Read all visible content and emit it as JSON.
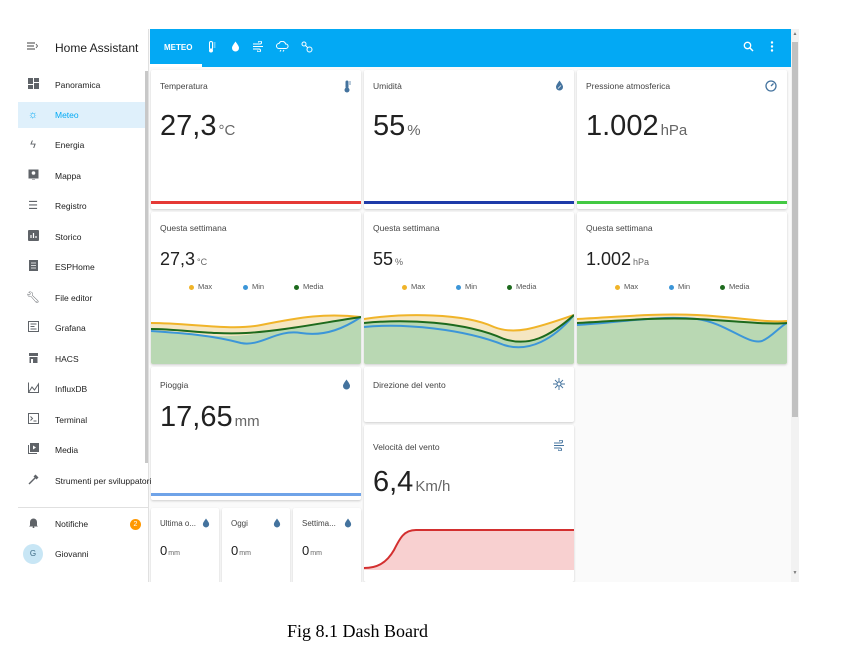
{
  "app_title": "Home Assistant",
  "sidebar": {
    "items": [
      {
        "label": "Panoramica",
        "icon": "dashboard-icon"
      },
      {
        "label": "Meteo",
        "icon": "weather-icon",
        "active": true
      },
      {
        "label": "Energia",
        "icon": "lightning-icon"
      },
      {
        "label": "Mappa",
        "icon": "map-icon"
      },
      {
        "label": "Registro",
        "icon": "list-icon"
      },
      {
        "label": "Storico",
        "icon": "chart-icon"
      },
      {
        "label": "ESPHome",
        "icon": "chip-icon"
      },
      {
        "label": "File editor",
        "icon": "wrench-icon"
      },
      {
        "label": "Grafana",
        "icon": "grafana-icon"
      },
      {
        "label": "HACS",
        "icon": "store-icon"
      },
      {
        "label": "InfluxDB",
        "icon": "chart-area-icon"
      },
      {
        "label": "Terminal",
        "icon": "terminal-icon"
      },
      {
        "label": "Media",
        "icon": "media-icon"
      },
      {
        "label": "Strumenti per sviluppatori",
        "icon": "hammer-icon"
      }
    ],
    "notifications": {
      "label": "Notifiche",
      "count": "2"
    },
    "user": {
      "label": "Giovanni",
      "initial": "G"
    }
  },
  "topbar": {
    "active_tab": "METEO",
    "tab_icons": [
      "thermometer-icon",
      "water-drop-icon",
      "wind-icon",
      "cloud-icon",
      "molecule-icon"
    ],
    "color": "#03a9f4"
  },
  "cards": {
    "temperature": {
      "title": "Temperatura",
      "value": "27,3",
      "unit": "°C",
      "color": "#e53935"
    },
    "humidity": {
      "title": "Umidità",
      "value": "55",
      "unit": "%",
      "color": "#1e3aa8"
    },
    "pressure": {
      "title": "Pressione atmosferica",
      "value": "1.002",
      "unit": "hPa",
      "color": "#43c943"
    },
    "temp_week": {
      "title": "Questa settimana",
      "value": "27,3",
      "unit": "°C"
    },
    "hum_week": {
      "title": "Questa settimana",
      "value": "55",
      "unit": "%"
    },
    "press_week": {
      "title": "Questa settimana",
      "value": "1.002",
      "unit": "hPa"
    },
    "legend": {
      "max": "Max",
      "min": "Min",
      "mean": "Media",
      "max_color": "#f0b429",
      "min_color": "#3c96d8",
      "mean_color": "#1d6a1d"
    },
    "rain": {
      "title": "Pioggia",
      "value": "17,65",
      "unit": "mm",
      "color": "#6fa3e8"
    },
    "wind_dir": {
      "title": "Direzione del vento"
    },
    "wind_speed": {
      "title": "Velocità del vento",
      "value": "6,4",
      "unit": "Km/h",
      "color": "#d32f2f"
    },
    "rain_last": {
      "title": "Ultima o...",
      "value": "0",
      "unit": "mm"
    },
    "rain_today": {
      "title": "Oggi",
      "value": "0",
      "unit": "mm"
    },
    "rain_week": {
      "title": "Settima...",
      "value": "0",
      "unit": "mm"
    }
  },
  "caption": "Fig 8.1 Dash Board"
}
